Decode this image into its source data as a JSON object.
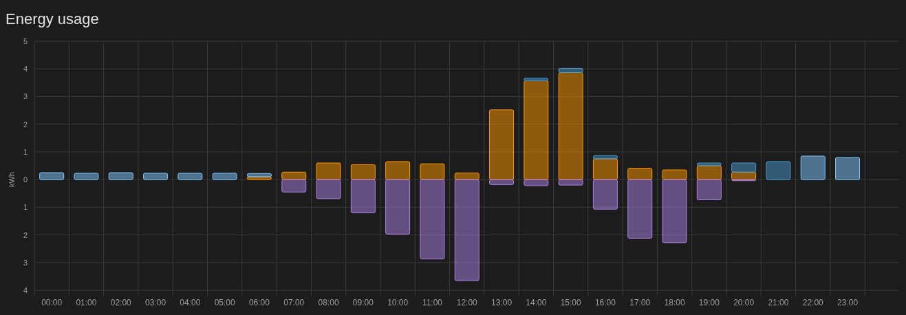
{
  "card": {
    "title": "Energy usage",
    "chart_data": {
      "type": "bar",
      "stacked": true,
      "grid": true,
      "ylabel": "kWh",
      "ylim": [
        -4,
        5
      ],
      "yticks": [
        {
          "value": -4,
          "label": "4"
        },
        {
          "value": -3,
          "label": "3"
        },
        {
          "value": -2,
          "label": "2"
        },
        {
          "value": -1,
          "label": "1"
        },
        0,
        1,
        2,
        3,
        4,
        5
      ],
      "categories": [
        "00:00",
        "01:00",
        "02:00",
        "03:00",
        "04:00",
        "05:00",
        "06:00",
        "07:00",
        "08:00",
        "09:00",
        "10:00",
        "11:00",
        "12:00",
        "13:00",
        "14:00",
        "15:00",
        "16:00",
        "17:00",
        "18:00",
        "19:00",
        "20:00",
        "21:00",
        "22:00",
        "23:00"
      ],
      "series": [
        {
          "color": "#ff9800",
          "values": [
            null,
            null,
            null,
            null,
            null,
            null,
            0.1,
            0.27,
            0.6,
            0.54,
            0.65,
            0.57,
            0.24,
            2.52,
            3.57,
            3.87,
            0.75,
            0.41,
            0.35,
            0.5,
            0.27,
            null,
            null,
            null
          ]
        },
        {
          "color": "#4a98cc",
          "values": [
            null,
            null,
            null,
            null,
            null,
            null,
            null,
            null,
            null,
            null,
            null,
            null,
            null,
            null,
            0.1,
            0.15,
            0.12,
            null,
            null,
            0.1,
            0.33,
            0.65,
            null,
            null
          ]
        },
        {
          "color": "#80c8ff",
          "values": [
            0.25,
            0.23,
            0.25,
            0.23,
            0.23,
            0.23,
            0.12,
            null,
            null,
            null,
            null,
            null,
            null,
            null,
            null,
            null,
            null,
            null,
            null,
            null,
            null,
            null,
            0.85,
            0.8
          ]
        },
        {
          "color": "#aa82e4",
          "values": [
            null,
            null,
            null,
            null,
            null,
            null,
            null,
            -0.45,
            -0.69,
            -1.2,
            -1.97,
            -2.87,
            -3.65,
            -0.18,
            -0.22,
            -0.2,
            -1.07,
            -2.12,
            -2.28,
            -0.73,
            -0.04,
            null,
            null,
            null
          ]
        }
      ]
    }
  }
}
